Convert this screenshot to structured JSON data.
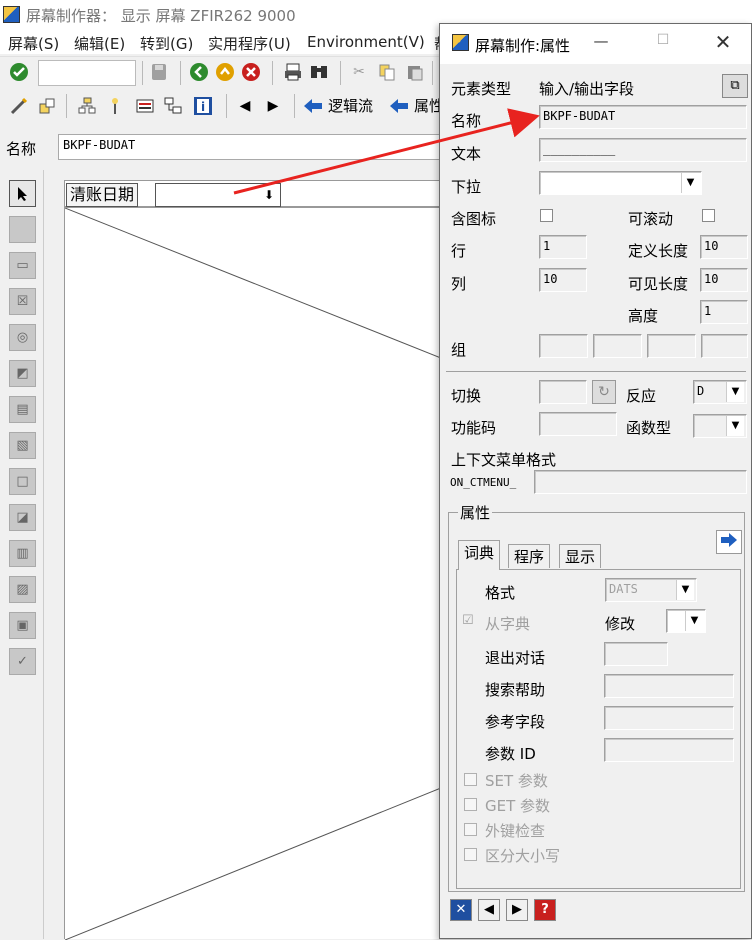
{
  "window": {
    "title": "屏幕制作器： 显示 屏幕 ZFIR262 9000"
  },
  "menu": [
    "屏幕(S)",
    "编辑(E)",
    "转到(G)",
    "实用程序(U)",
    "Environment(V)",
    "帮"
  ],
  "toolbar2": {
    "logic_flow_label": "逻辑流",
    "attributes_label": "属性"
  },
  "main": {
    "name_label": "名称",
    "name_value": "BKPF-BUDAT",
    "field_label": "清账日期"
  },
  "dialog": {
    "title": "屏幕制作:属性",
    "element_type_label": "元素类型",
    "element_type_value": "输入/输出字段",
    "name_label": "名称",
    "name_value": "BKPF-BUDAT",
    "text_label": "文本",
    "text_value": "__________",
    "dropdown_label": "下拉",
    "with_icon_label": "含图标",
    "scrollable_label": "可滚动",
    "row_label": "行",
    "row_value": "1",
    "def_length_label": "定义长度",
    "def_length_value": "10",
    "col_label": "列",
    "col_value": "10",
    "vis_length_label": "可见长度",
    "vis_length_value": "10",
    "height_label": "高度",
    "height_value": "1",
    "group_label": "组",
    "switch_label": "切换",
    "response_label": "反应",
    "response_value": "D",
    "func_code_label": "功能码",
    "func_type_label": "函数型",
    "ctx_menu_label": "上下文菜单格式",
    "ctx_menu_prefix": "ON_CTMENU_",
    "props_group_label": "属性",
    "tabs": [
      "词典",
      "程序",
      "显示"
    ],
    "format_label": "格式",
    "format_value": "DATS",
    "from_dict_label": "从字典",
    "modify_label": "修改",
    "exit_dialog_label": "退出对话",
    "search_help_label": "搜索帮助",
    "ref_field_label": "参考字段",
    "param_id_label": "参数 ID",
    "set_param_label": "SET 参数",
    "get_param_label": "GET 参数",
    "foreign_key_label": "外键检查",
    "case_sensitive_label": "区分大小写"
  },
  "colors": {
    "annotation_arrow": "#e8231f",
    "accent_blue": "#1f5fbf"
  }
}
